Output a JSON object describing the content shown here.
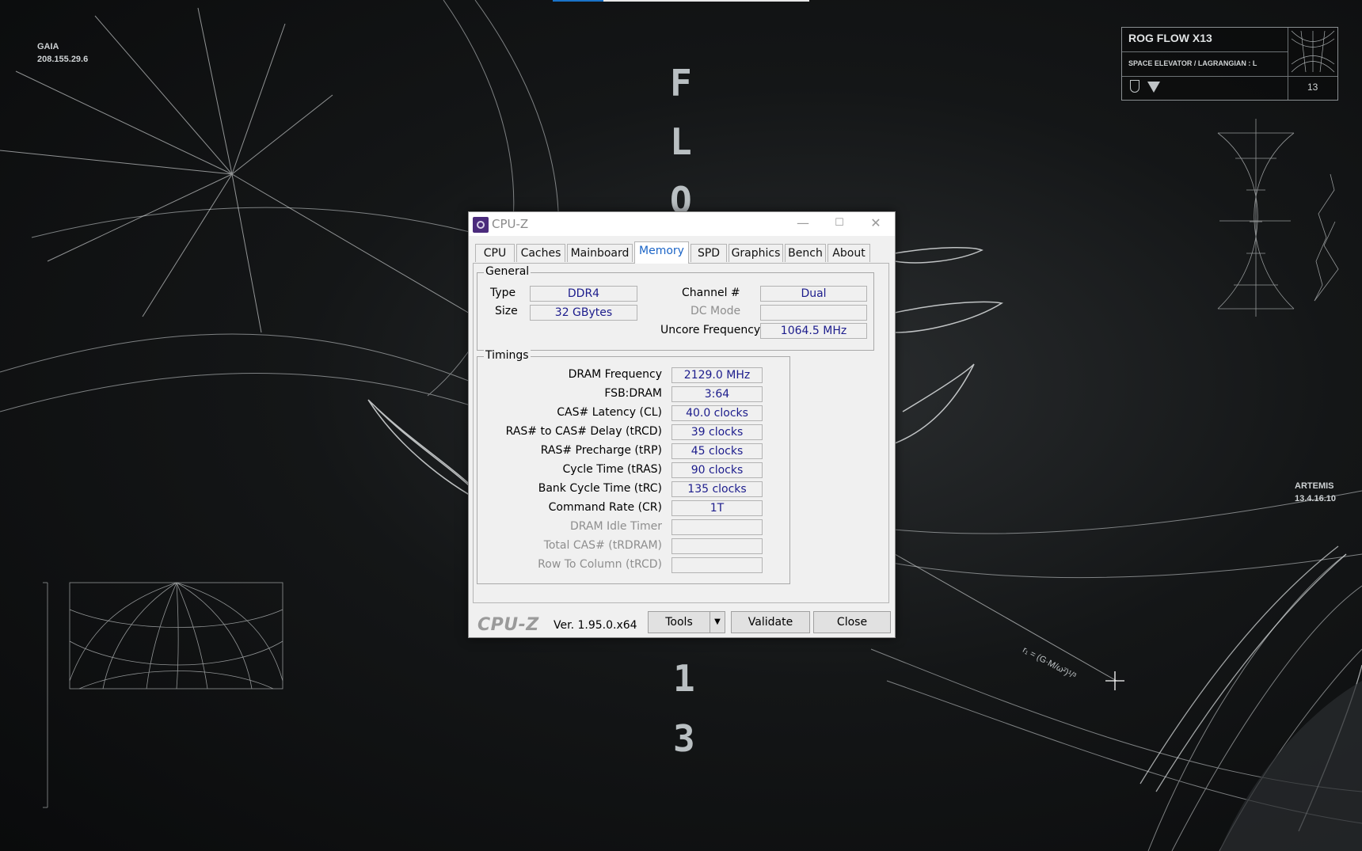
{
  "desktop": {
    "gaia_label": "GAIA",
    "gaia_ip": "208.155.29.6",
    "artemis_label": "ARTEMIS",
    "artemis_ip": "13.4.16.10",
    "vertical_letters": [
      "F",
      "L",
      "O"
    ],
    "vertical_digits": [
      "1",
      "3"
    ],
    "formula": "r₁ = (G·M/ω²)¹/³",
    "rog_card": {
      "title": "ROG FLOW X13",
      "subtitle": "SPACE ELEVATOR / LAGRANGIAN : L",
      "number": "13"
    }
  },
  "window": {
    "title": "CPU-Z",
    "min_glyph": "—",
    "max_glyph": "☐",
    "close_glyph": "✕",
    "tabs": [
      "CPU",
      "Caches",
      "Mainboard",
      "Memory",
      "SPD",
      "Graphics",
      "Bench",
      "About"
    ],
    "active_tab": "Memory",
    "general": {
      "title": "General",
      "type_label": "Type",
      "type_value": "DDR4",
      "size_label": "Size",
      "size_value": "32 GBytes",
      "channel_label": "Channel #",
      "channel_value": "Dual",
      "dcmode_label": "DC Mode",
      "dcmode_value": "",
      "uncore_label": "Uncore Frequency",
      "uncore_value": "1064.5 MHz"
    },
    "timings": {
      "title": "Timings",
      "rows": [
        {
          "label": "DRAM Frequency",
          "value": "2129.0 MHz",
          "disabled": false
        },
        {
          "label": "FSB:DRAM",
          "value": "3:64",
          "disabled": false
        },
        {
          "label": "CAS# Latency (CL)",
          "value": "40.0 clocks",
          "disabled": false
        },
        {
          "label": "RAS# to CAS# Delay (tRCD)",
          "value": "39 clocks",
          "disabled": false
        },
        {
          "label": "RAS# Precharge (tRP)",
          "value": "45 clocks",
          "disabled": false
        },
        {
          "label": "Cycle Time (tRAS)",
          "value": "90 clocks",
          "disabled": false
        },
        {
          "label": "Bank Cycle Time (tRC)",
          "value": "135 clocks",
          "disabled": false
        },
        {
          "label": "Command Rate (CR)",
          "value": "1T",
          "disabled": false
        },
        {
          "label": "DRAM Idle Timer",
          "value": "",
          "disabled": true
        },
        {
          "label": "Total CAS# (tRDRAM)",
          "value": "",
          "disabled": true
        },
        {
          "label": "Row To Column (tRCD)",
          "value": "",
          "disabled": true
        }
      ]
    },
    "footer": {
      "brand": "CPU-Z",
      "version": "Ver. 1.95.0.x64",
      "tools_label": "Tools",
      "validate_label": "Validate",
      "close_label": "Close"
    }
  }
}
